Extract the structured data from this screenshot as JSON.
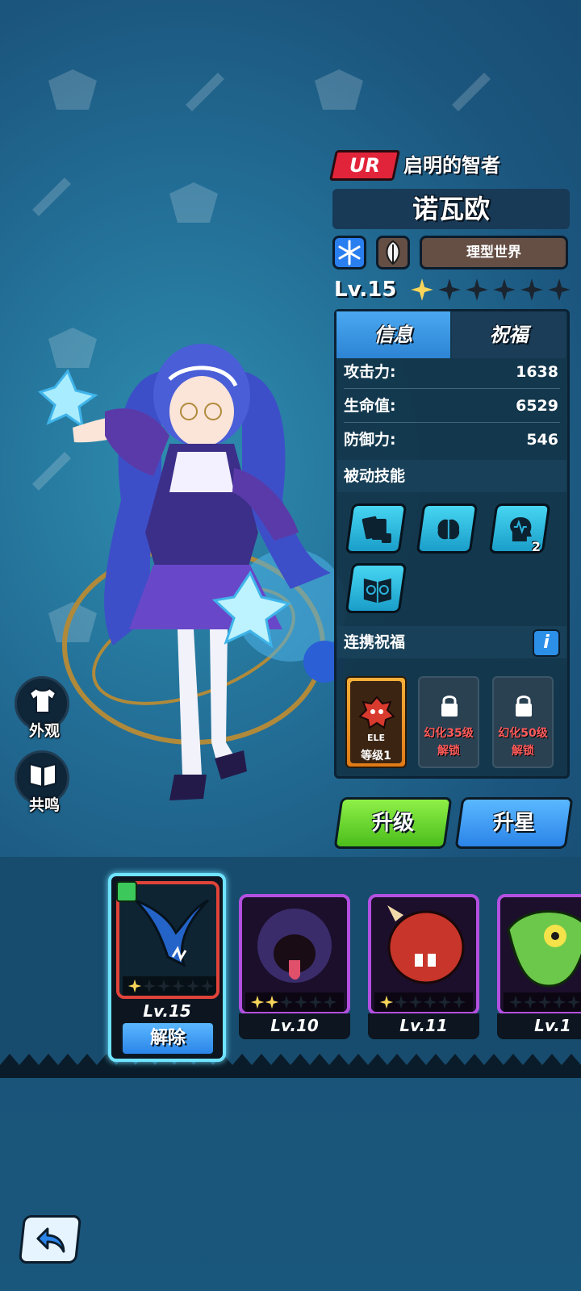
{
  "hero": {
    "rarity": "UR",
    "title": "启明的智者",
    "name": "诺瓦欧",
    "element_icon": "snowflake-icon",
    "class_icon": "feather-icon",
    "faction": "理型世界",
    "level": "Lv.15",
    "stars_filled": 1,
    "stars_total": 6
  },
  "tabs": {
    "info": "信息",
    "bless": "祝福",
    "active": "info"
  },
  "stats": [
    {
      "label": "攻击力:",
      "value": "1638"
    },
    {
      "label": "生命值:",
      "value": "6529"
    },
    {
      "label": "防御力:",
      "value": "546"
    }
  ],
  "passive_skills": {
    "header": "被动技能",
    "skills": [
      {
        "icon": "cards-dice-icon",
        "badge": ""
      },
      {
        "icon": "brain-icon",
        "badge": ""
      },
      {
        "icon": "mind-wave-icon",
        "badge": "2"
      },
      {
        "icon": "gear-book-icon",
        "badge": ""
      }
    ]
  },
  "bond_bless": {
    "header": "连携祝福",
    "info_label": "i",
    "active": {
      "tag": "ELE",
      "level": "等级1"
    },
    "locked": [
      {
        "line1": "幻化35级",
        "line2": "解锁"
      },
      {
        "line1": "幻化50级",
        "line2": "解锁"
      }
    ]
  },
  "buttons": {
    "upgrade": "升级",
    "star_up": "升星",
    "appearance": "外观",
    "resonance": "共鸣"
  },
  "pets": [
    {
      "level": "Lv.15",
      "stars_filled": 1,
      "selected": true,
      "action": "解除",
      "frame_color": "#e0433a"
    },
    {
      "level": "Lv.10",
      "stars_filled": 2,
      "selected": false,
      "frame_color": "#b350e0"
    },
    {
      "level": "Lv.11",
      "stars_filled": 1,
      "selected": false,
      "frame_color": "#b350e0"
    },
    {
      "level": "Lv.1",
      "stars_filled": 0,
      "selected": false,
      "frame_color": "#b350e0"
    }
  ],
  "colors": {
    "star_gold": "#f8d55a",
    "star_empty": "#1a2530",
    "accent_blue": "#2d84d4",
    "accent_green": "#4bbd1c"
  }
}
